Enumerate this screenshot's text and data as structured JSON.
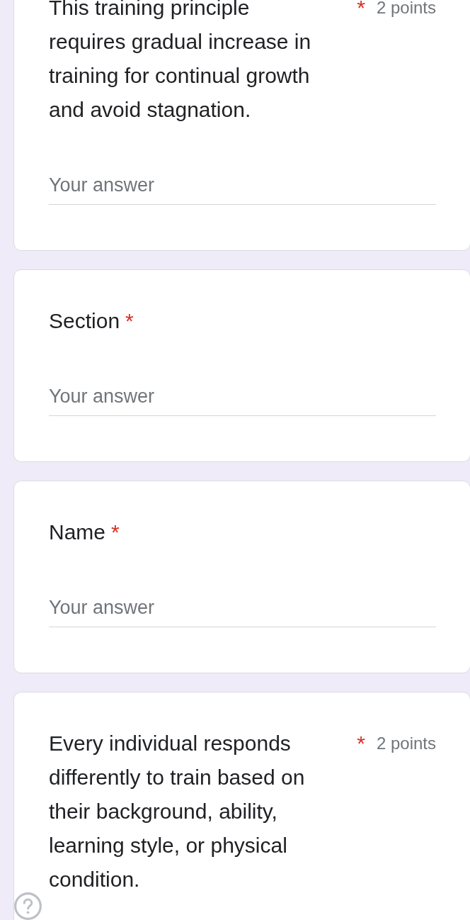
{
  "questions": [
    {
      "title": "This training principle requires gradual increase in training for continual growth and avoid stagnation.",
      "required_mark": "*",
      "points": "2 points",
      "answer": {
        "placeholder": "Your answer"
      }
    },
    {
      "title": "Section",
      "required_mark": "*",
      "answer": {
        "placeholder": "Your answer"
      }
    },
    {
      "title": "Name",
      "required_mark": "*",
      "answer": {
        "placeholder": "Your answer"
      }
    },
    {
      "title": "Every individual responds differently to train based on their background, ability, learning style, or physical condition.",
      "required_mark": "*",
      "points": "2 points"
    }
  ]
}
